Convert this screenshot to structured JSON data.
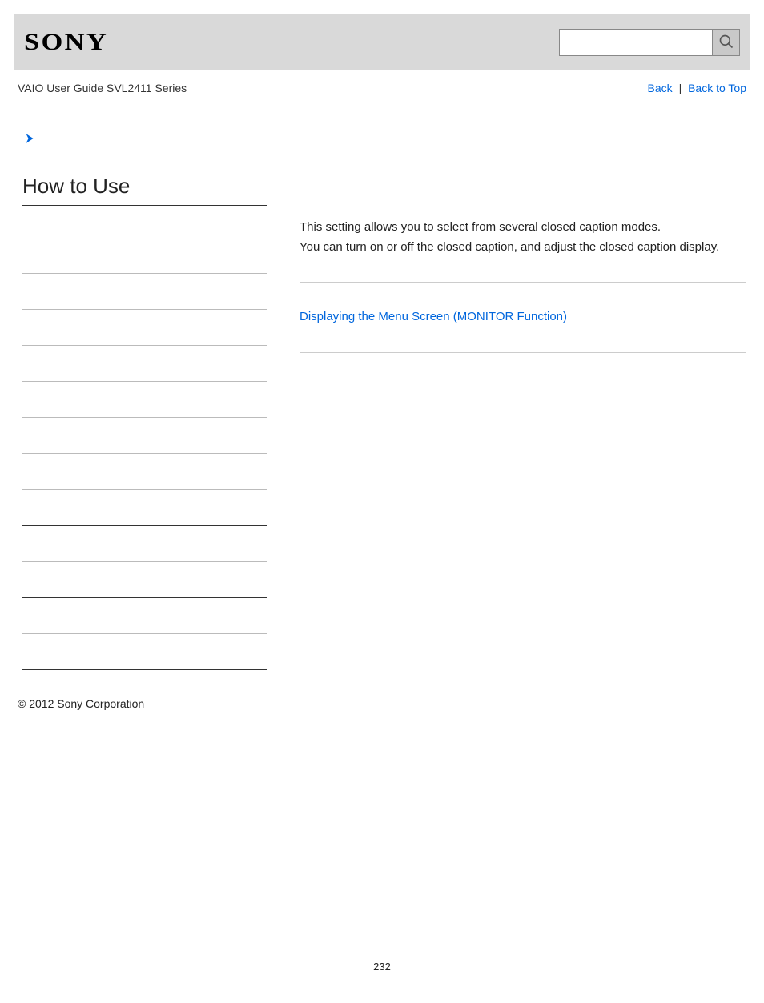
{
  "header": {
    "logo_text": "SONY"
  },
  "subheader": {
    "guide_title": "VAIO User Guide SVL2411 Series",
    "back_label": "Back",
    "back_to_top_label": "Back to Top",
    "separator": "|"
  },
  "sidebar": {
    "title": "How to Use"
  },
  "content": {
    "paragraph1": "This setting allows you to select from several closed caption modes.",
    "paragraph2": "You can turn on or off the closed caption, and adjust the closed caption display.",
    "related_link": "Displaying the Menu Screen (MONITOR Function)"
  },
  "footer": {
    "copyright": "© 2012 Sony Corporation",
    "page_number": "232"
  }
}
